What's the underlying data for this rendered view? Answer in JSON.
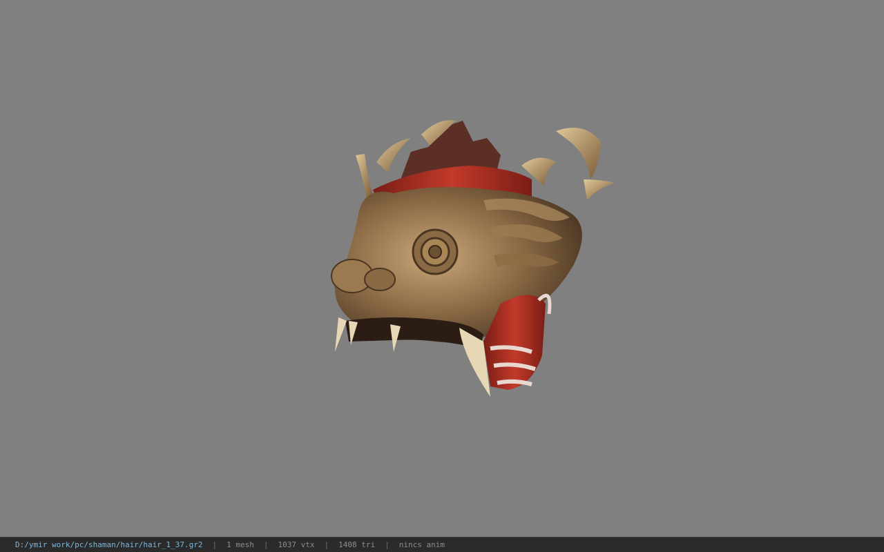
{
  "status_bar": {
    "file_path": "D:/ymir work/pc/shaman/hair/hair_1_37.gr2",
    "mesh_count": "1 mesh",
    "vertex_count": "1037 vtx",
    "triangle_count": "1408 tri",
    "animation": "nincs anim",
    "separator": "|"
  },
  "colors": {
    "viewport_background": "#808080",
    "status_bar_background": "#2b2b2b",
    "path_text": "#7fb7d8",
    "stat_text": "#8c8c8c"
  },
  "icons": {
    "model": "dragon-head-helmet-model"
  }
}
